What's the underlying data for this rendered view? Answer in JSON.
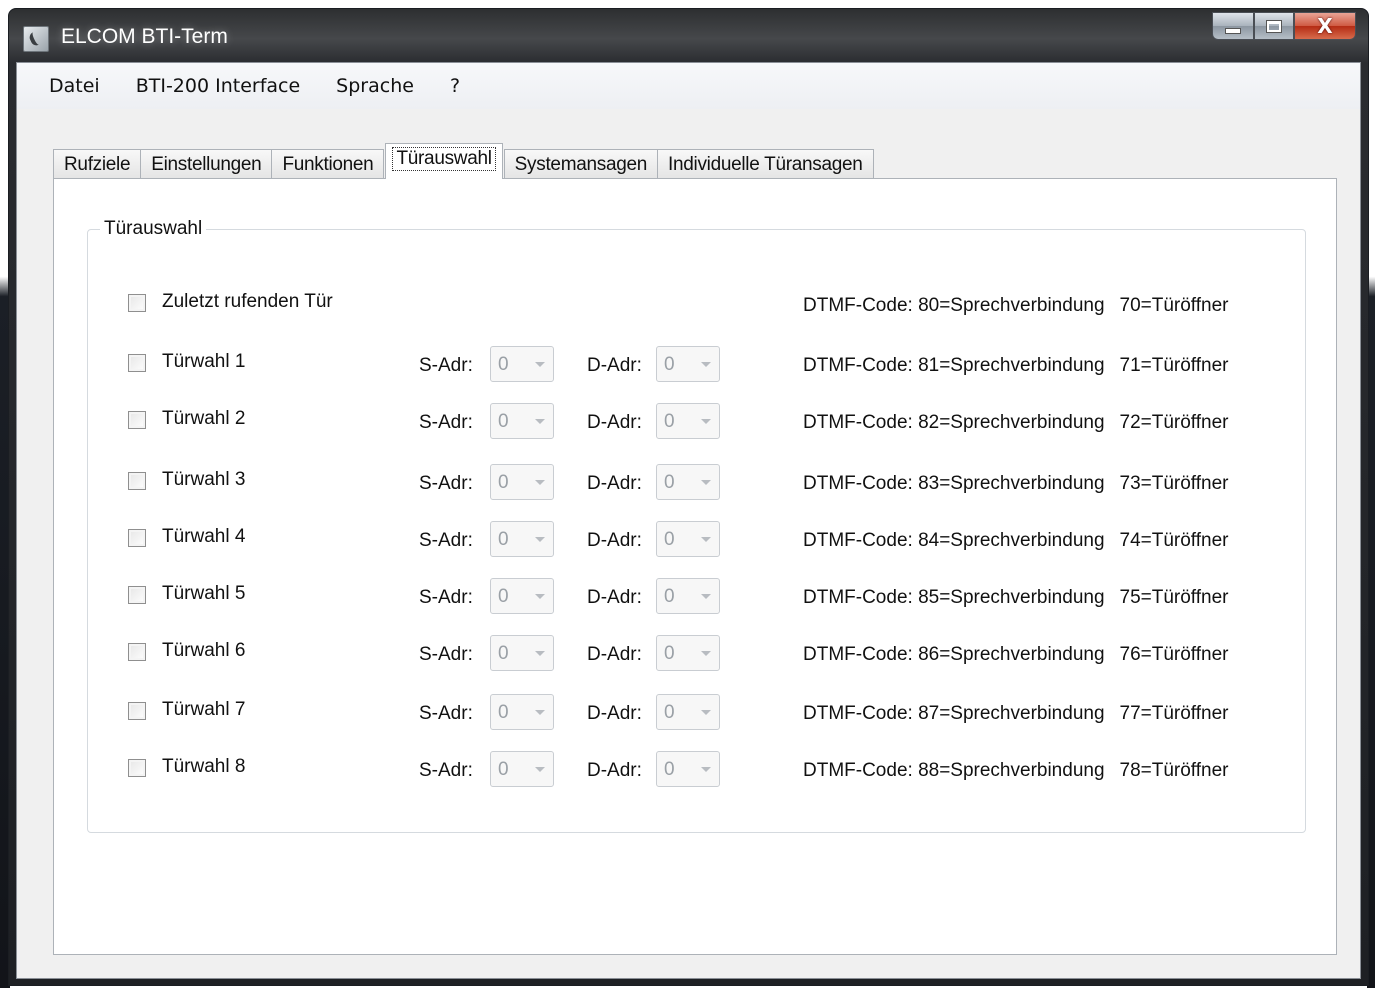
{
  "window": {
    "title": "ELCOM BTI-Term",
    "close_glyph": "X"
  },
  "menu": [
    "Datei",
    "BTI-200 Interface",
    "Sprache",
    "?"
  ],
  "tabs": [
    {
      "label": "Rufziele",
      "active": false
    },
    {
      "label": "Einstellungen",
      "active": false
    },
    {
      "label": "Funktionen",
      "active": false
    },
    {
      "label": "Türauswahl",
      "active": true
    },
    {
      "label": "Systemansagen",
      "active": false
    },
    {
      "label": "Individuelle Türansagen",
      "active": false
    }
  ],
  "group": {
    "title": "Türauswahl",
    "s_adr_label": "S-Adr:",
    "d_adr_label": "D-Adr:",
    "last_caller": {
      "label": "Zuletzt rufenden Tür",
      "checked": false,
      "dtmf_talk": "DTMF-Code: 80=Sprechverbindung",
      "dtmf_open": "70=Türöffner"
    },
    "rows": [
      {
        "label": "Türwahl 1",
        "checked": false,
        "s_adr": "0",
        "d_adr": "0",
        "dtmf_talk": "DTMF-Code: 81=Sprechverbindung",
        "dtmf_open": "71=Türöffner"
      },
      {
        "label": "Türwahl 2",
        "checked": false,
        "s_adr": "0",
        "d_adr": "0",
        "dtmf_talk": "DTMF-Code: 82=Sprechverbindung",
        "dtmf_open": "72=Türöffner"
      },
      {
        "label": "Türwahl 3",
        "checked": false,
        "s_adr": "0",
        "d_adr": "0",
        "dtmf_talk": "DTMF-Code: 83=Sprechverbindung",
        "dtmf_open": "73=Türöffner"
      },
      {
        "label": "Türwahl 4",
        "checked": false,
        "s_adr": "0",
        "d_adr": "0",
        "dtmf_talk": "DTMF-Code: 84=Sprechverbindung",
        "dtmf_open": "74=Türöffner"
      },
      {
        "label": "Türwahl 5",
        "checked": false,
        "s_adr": "0",
        "d_adr": "0",
        "dtmf_talk": "DTMF-Code: 85=Sprechverbindung",
        "dtmf_open": "75=Türöffner"
      },
      {
        "label": "Türwahl 6",
        "checked": false,
        "s_adr": "0",
        "d_adr": "0",
        "dtmf_talk": "DTMF-Code: 86=Sprechverbindung",
        "dtmf_open": "76=Türöffner"
      },
      {
        "label": "Türwahl 7",
        "checked": false,
        "s_adr": "0",
        "d_adr": "0",
        "dtmf_talk": "DTMF-Code: 87=Sprechverbindung",
        "dtmf_open": "77=Türöffner"
      },
      {
        "label": "Türwahl 8",
        "checked": false,
        "s_adr": "0",
        "d_adr": "0",
        "dtmf_talk": "DTMF-Code: 88=Sprechverbindung",
        "dtmf_open": "78=Türöffner"
      }
    ]
  }
}
